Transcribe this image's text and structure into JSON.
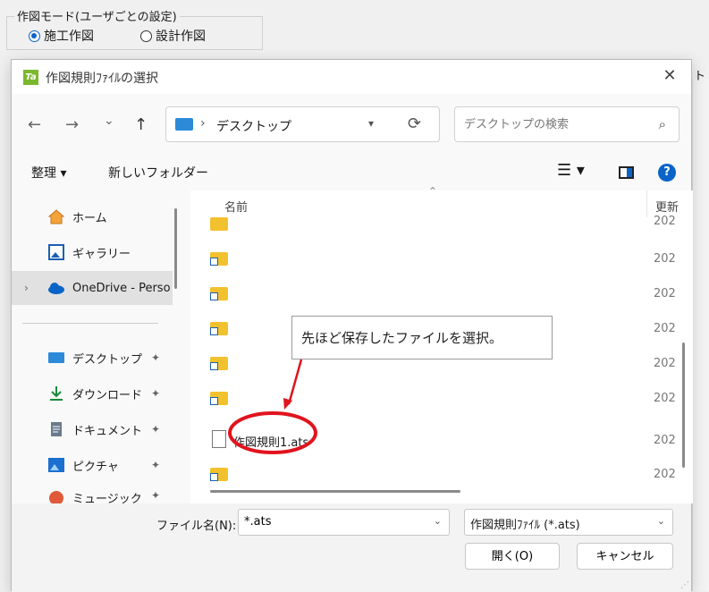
{
  "background": {
    "group_label": "作図モード(ユーザごとの設定)",
    "radio_construction": "施工作図",
    "radio_design": "設計作図",
    "fragment": "ト"
  },
  "dialog": {
    "title": "作図規則ﾌｧｲﾙの選択",
    "close_glyph": "✕"
  },
  "nav": {
    "back": "←",
    "forward": "→",
    "recent": "⌄",
    "up": "↑",
    "path_sep": "›",
    "path": "デスクトップ",
    "refresh": "⟳",
    "search_placeholder": "デスクトップの検索"
  },
  "toolbar": {
    "organize": "整理 ▾",
    "new_folder": "新しいフォルダー",
    "view_glyph": "☰ ▾",
    "help_glyph": "?"
  },
  "sidebar": {
    "items": [
      {
        "label": "ホーム",
        "icon": "home-icon"
      },
      {
        "label": "ギャラリー",
        "icon": "gallery-icon"
      },
      {
        "label": "OneDrive - Perso",
        "icon": "cloud-icon"
      },
      {
        "label": "デスクトップ",
        "icon": "desktop-icon"
      },
      {
        "label": "ダウンロード",
        "icon": "download-icon"
      },
      {
        "label": "ドキュメント",
        "icon": "document-icon"
      },
      {
        "label": "ピクチャ",
        "icon": "pictures-icon"
      },
      {
        "label": "ミュージック",
        "icon": "music-icon"
      }
    ],
    "pin_glyph": "📌"
  },
  "files": {
    "col_name": "名前",
    "col_date": "更新",
    "rows": [
      {
        "name": "",
        "date": "202"
      },
      {
        "name": "",
        "date": "202"
      },
      {
        "name": "",
        "date": "202"
      },
      {
        "name": "",
        "date": "202"
      },
      {
        "name": "",
        "date": "202"
      },
      {
        "name": "",
        "date": "202"
      },
      {
        "name": "作図規則1.ats",
        "date": "202"
      },
      {
        "name": "",
        "date": "202"
      }
    ]
  },
  "annotation": {
    "callout_text": "先ほど保存したファイルを選択。",
    "accent_color": "#e0141e"
  },
  "footer": {
    "filename_label": "ファイル名(N):",
    "filename_value": "*.ats",
    "filetype_value": "作図規則ﾌｧｲﾙ (*.ats)",
    "open_label": "開く(O)",
    "cancel_label": "キャンセル"
  }
}
